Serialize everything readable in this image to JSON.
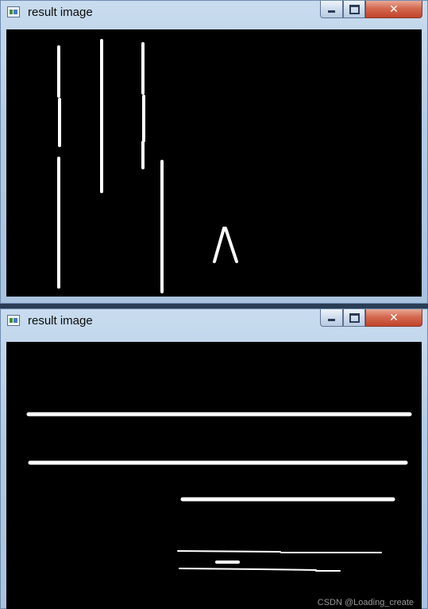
{
  "windows": [
    {
      "title": "result image",
      "buttons": {
        "minimize": "minimize",
        "maximize": "maximize",
        "close": "close"
      },
      "content": "vertical-line-segments"
    },
    {
      "title": "result image",
      "buttons": {
        "minimize": "minimize",
        "maximize": "maximize",
        "close": "close"
      },
      "content": "horizontal-line-segments"
    }
  ],
  "watermark": "CSDN @Loading_create",
  "colors": {
    "canvas": "#000000",
    "lines": "#ffffff",
    "close_button": "#c84a30"
  }
}
